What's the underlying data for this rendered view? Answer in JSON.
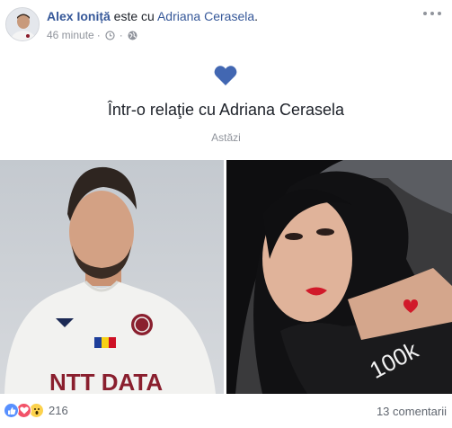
{
  "header": {
    "author_name": "Alex Ioniță",
    "with_text": " este cu ",
    "tagged_name": "Adriana Cerasela",
    "period": ".",
    "timestamp": "46 minute",
    "separator": "·",
    "privacy_icon": "globe-icon",
    "clock_icon": "clock-icon",
    "more_icon": "more-options-icon"
  },
  "life_event": {
    "icon": "heart-icon",
    "icon_color": "#4267b2",
    "title": "Într-o relaţie cu Adriana Cerasela",
    "date": "Astăzi"
  },
  "photos": [
    {
      "subject": "man-in-white-jersey",
      "description_icon": "photo-man"
    },
    {
      "subject": "woman-with-dark-hair",
      "description_icon": "photo-woman"
    }
  ],
  "footer": {
    "reactions": [
      "like-icon",
      "love-icon",
      "wow-icon"
    ],
    "reaction_count": "216",
    "comments": "13 comentarii"
  },
  "colors": {
    "link": "#365899",
    "text": "#1d2129",
    "muted": "#90949c",
    "like": "#5890ff",
    "love": "#f25268",
    "wow": "#fcd24d"
  }
}
